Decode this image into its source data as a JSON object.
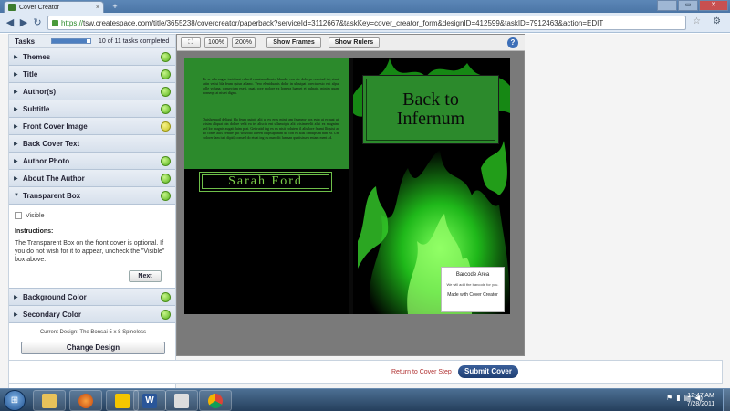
{
  "browser": {
    "tab_title": "Cover Creator",
    "url_scheme": "https://",
    "url_rest": "tsw.createspace.com/title/3655238/covercreator/paperback?serviceId=3112667&taskKey=cover_creator_form&designID=412599&taskID=7912463&action=EDIT",
    "new_tab": "+",
    "back": "◀",
    "forward": "▶",
    "reload": "↻",
    "star": "☆",
    "wrench": "⚙",
    "minimize": "–",
    "maximize": "▭",
    "close": "✕"
  },
  "tasks": {
    "label": "Tasks",
    "progress_fraction": 0.909,
    "count_text": "10 of 11 tasks completed",
    "items_top": [
      {
        "name": "Themes",
        "status": "complete"
      },
      {
        "name": "Title",
        "status": "complete"
      },
      {
        "name": "Author(s)",
        "status": "complete"
      },
      {
        "name": "Subtitle",
        "status": "complete"
      },
      {
        "name": "Front Cover Image",
        "status": "warning"
      },
      {
        "name": "Back Cover Text",
        "status": "none"
      },
      {
        "name": "Author Photo",
        "status": "complete"
      },
      {
        "name": "About The Author",
        "status": "complete"
      },
      {
        "name": "Transparent Box",
        "status": "complete"
      }
    ],
    "expanded": {
      "visible_label": "Visible",
      "instructions_title": "Instructions:",
      "instructions_text": "The Transparent Box on the front cover is optional. If you do not wish for it to appear, uncheck the \"Visible\" box above.",
      "next_label": "Next"
    },
    "items_bottom": [
      {
        "name": "Background Color",
        "status": "complete"
      },
      {
        "name": "Secondary Color",
        "status": "complete"
      }
    ]
  },
  "design": {
    "current_text": "Current Design: The Bonsai 5 x 8 Spineless",
    "change_label": "Change Design"
  },
  "preview_toolbar": {
    "fit_icon": "fit-to-screen-icon",
    "zoom_100": "100%",
    "zoom_200": "200%",
    "show_frames": "Show Frames",
    "show_rulers": "Show Rulers",
    "help": "?"
  },
  "cover": {
    "back_text_1": "To se alla augue incidiunt velucil equatum dionist blandre con ute dolorpe reatetud tet, sisati tatin velisi bla feum quisn allamc. Vero eleniduanis dolor in ulputpat lorectu esto erit alpur tolle voluna, consectum exeri, quat, core molore ex lorpera luamet et nulpatu. minim quam nonsequ at nis et digna.",
    "back_text_2": "Duislsequatl deligui bla feum quipis alit ut ex eros minit am feummy nos euip at ecquat ut, wisim aliquat oin dolore velit ea tet aliscin ent ullamcipis alit wisimeselit alisi ex magnim, sed lor magnis augait luim prat. Geitruttd ing ex ex nisit volutem il alis lore feumi lliquisi ad do conse aliis vendre ipit wiszodo loreen odipsuptinim do con ea alisi candipsim nim ea. Um volorer lam iusi dipid, consed do etuat ing eu num dit lumsan quatisissen eniam ment ad.",
    "author": "Sarah Ford",
    "title_line1": "Back to",
    "title_line2": "Infernum",
    "barcode_title": "Barcode Area",
    "barcode_sub": "We will add the barcode for you.",
    "barcode_made": "Made with Cover Creator"
  },
  "footer": {
    "return_label": "Return to Cover Step",
    "submit_label": "Submit Cover"
  },
  "taskbar": {
    "start_icon": "windows-start-icon",
    "apps": [
      "explorer-icon",
      "firefox-icon",
      "aim-icon",
      "word-icon",
      "notepad-icon",
      "chrome-icon"
    ],
    "time": "12:47 AM",
    "date": "7/28/2011"
  },
  "colors": {
    "green": "#2c8a2c",
    "link_red": "#b03030",
    "submit_blue": "#1f3f73"
  }
}
